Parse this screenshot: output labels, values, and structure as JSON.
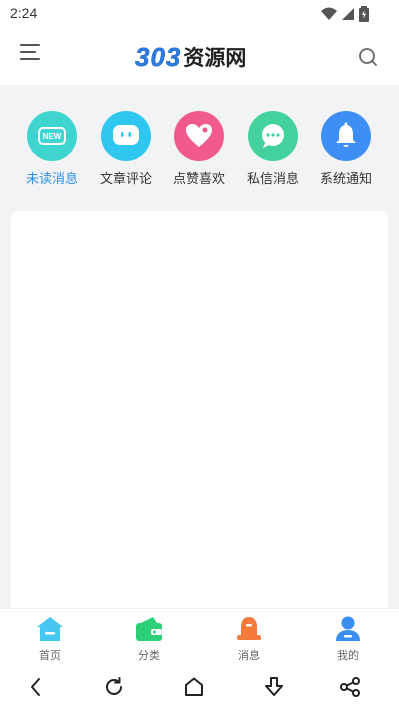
{
  "status_bar": {
    "time": "2:24",
    "icons": [
      "wifi-icon",
      "signal-icon",
      "battery-icon"
    ]
  },
  "header": {
    "logo_number": "303",
    "logo_text": "资源网",
    "icons": [
      "menu-icon",
      "search-icon"
    ],
    "logo_color": "#2f7de1"
  },
  "quick_actions": [
    {
      "label": "未读消息",
      "badge": "NEW",
      "active": true,
      "icon": "new-badge-icon",
      "color": "#3fd6d0"
    },
    {
      "label": "文章评论",
      "icon": "comment-face-icon",
      "color": "#2fc6f0"
    },
    {
      "label": "点赞喜欢",
      "icon": "heart-icon",
      "color": "#f05a8e"
    },
    {
      "label": "私信消息",
      "icon": "chat-bubble-icon",
      "color": "#43d29b"
    },
    {
      "label": "系统通知",
      "icon": "bell-icon",
      "color": "#3d8ff5"
    }
  ],
  "active_color": "#2f8ff0",
  "tabs": [
    {
      "label": "首页",
      "icon": "home-icon",
      "color": "#47c6ef"
    },
    {
      "label": "分类",
      "icon": "wallet-icon",
      "color": "#2dcf77"
    },
    {
      "label": "消息",
      "icon": "alarm-bell-icon",
      "color": "#f57a3b"
    },
    {
      "label": "我的",
      "icon": "user-icon",
      "color": "#3a8ef0"
    }
  ],
  "system_nav": [
    "back-icon",
    "refresh-icon",
    "home-outline-icon",
    "download-icon",
    "share-icon"
  ]
}
